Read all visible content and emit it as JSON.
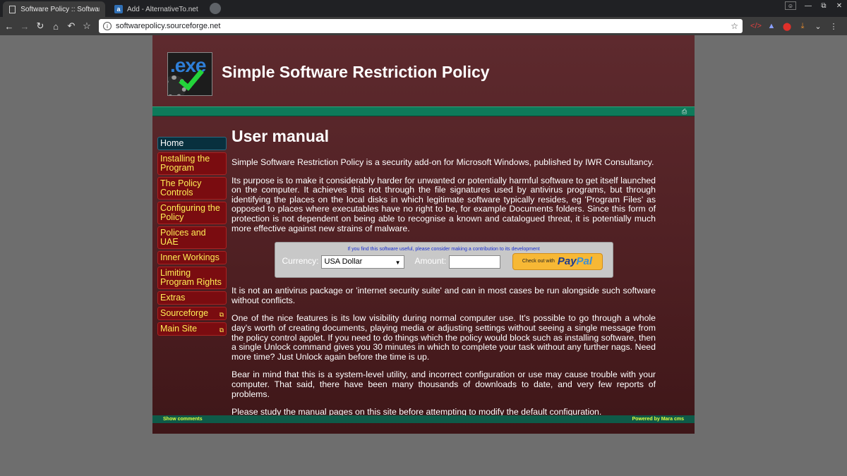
{
  "browser": {
    "tabs": [
      {
        "title": "Software Policy :: Software",
        "active": true,
        "icon": "document-icon"
      },
      {
        "title": "Add - AlternativeTo.net",
        "active": false,
        "icon": "alternativeto-icon",
        "icon_letter": "a"
      }
    ],
    "url": "softwarepolicy.sourceforge.net"
  },
  "site": {
    "title": "Simple Software Restriction Policy",
    "logo_text": ".exe"
  },
  "sidebar": {
    "items": [
      {
        "label": "Home",
        "active": true,
        "external": false
      },
      {
        "label": "Installing the Program",
        "active": false,
        "external": false
      },
      {
        "label": "The Policy Controls",
        "active": false,
        "external": false
      },
      {
        "label": "Configuring the Policy",
        "active": false,
        "external": false
      },
      {
        "label": "Polices and UAE",
        "active": false,
        "external": false
      },
      {
        "label": "Inner Workings",
        "active": false,
        "external": false
      },
      {
        "label": "Limiting Program Rights",
        "active": false,
        "external": false
      },
      {
        "label": "Extras",
        "active": false,
        "external": false
      },
      {
        "label": "Sourceforge",
        "active": false,
        "external": true
      },
      {
        "label": "Main Site",
        "active": false,
        "external": true
      }
    ]
  },
  "main": {
    "heading": "User manual",
    "para1": "Simple Software Restriction Policy is a security add-on for Microsoft Windows, published by IWR Consultancy.",
    "para2": "Its purpose is to make it considerably harder for unwanted or potentially harmful software to get itself launched on the computer. It achieves this not through the file signatures used by antivirus programs, but through identifying the places on the local disks in which legitimate software typically resides, eg 'Program Files' as opposed to places where executables have no right to be, for example Documents folders. Since this form of protection is not dependent on being able to recognise a known and catalogued threat, it is potentially much more effective against new strains of malware.",
    "para3": "It is not an antivirus package or 'internet security suite' and can in most cases be run alongside such software without conflicts.",
    "para4": "One of the nice features is its low visibility during normal computer use. It's possible to go through a whole day's worth of creating documents, playing media or adjusting settings without seeing a single message from the policy control applet. If you need to do things which the policy would block such as installing software, then a single Unlock command gives you 30 minutes in which to complete your task without any further nags. Need more time? Just Unlock again before the time is up.",
    "para5": "Bear in mind that this is a system-level utility, and incorrect configuration or use may cause trouble with your computer. That said, there have been many thousands of downloads to date, and very few reports of problems.",
    "para6": "Please study the manual pages on this site before attempting to modify the default configuration."
  },
  "donate": {
    "note": "If you find this software useful, please consider making a contribution to its development",
    "currency_label": "Currency:",
    "currency_value": "USA Dollar",
    "amount_label": "Amount:",
    "amount_value": "",
    "checkout_small": "Check out with",
    "paypal_pay": "Pay",
    "paypal_pal": "Pal"
  },
  "footer": {
    "left": "Show comments",
    "right": "Powered by Mara cms"
  }
}
